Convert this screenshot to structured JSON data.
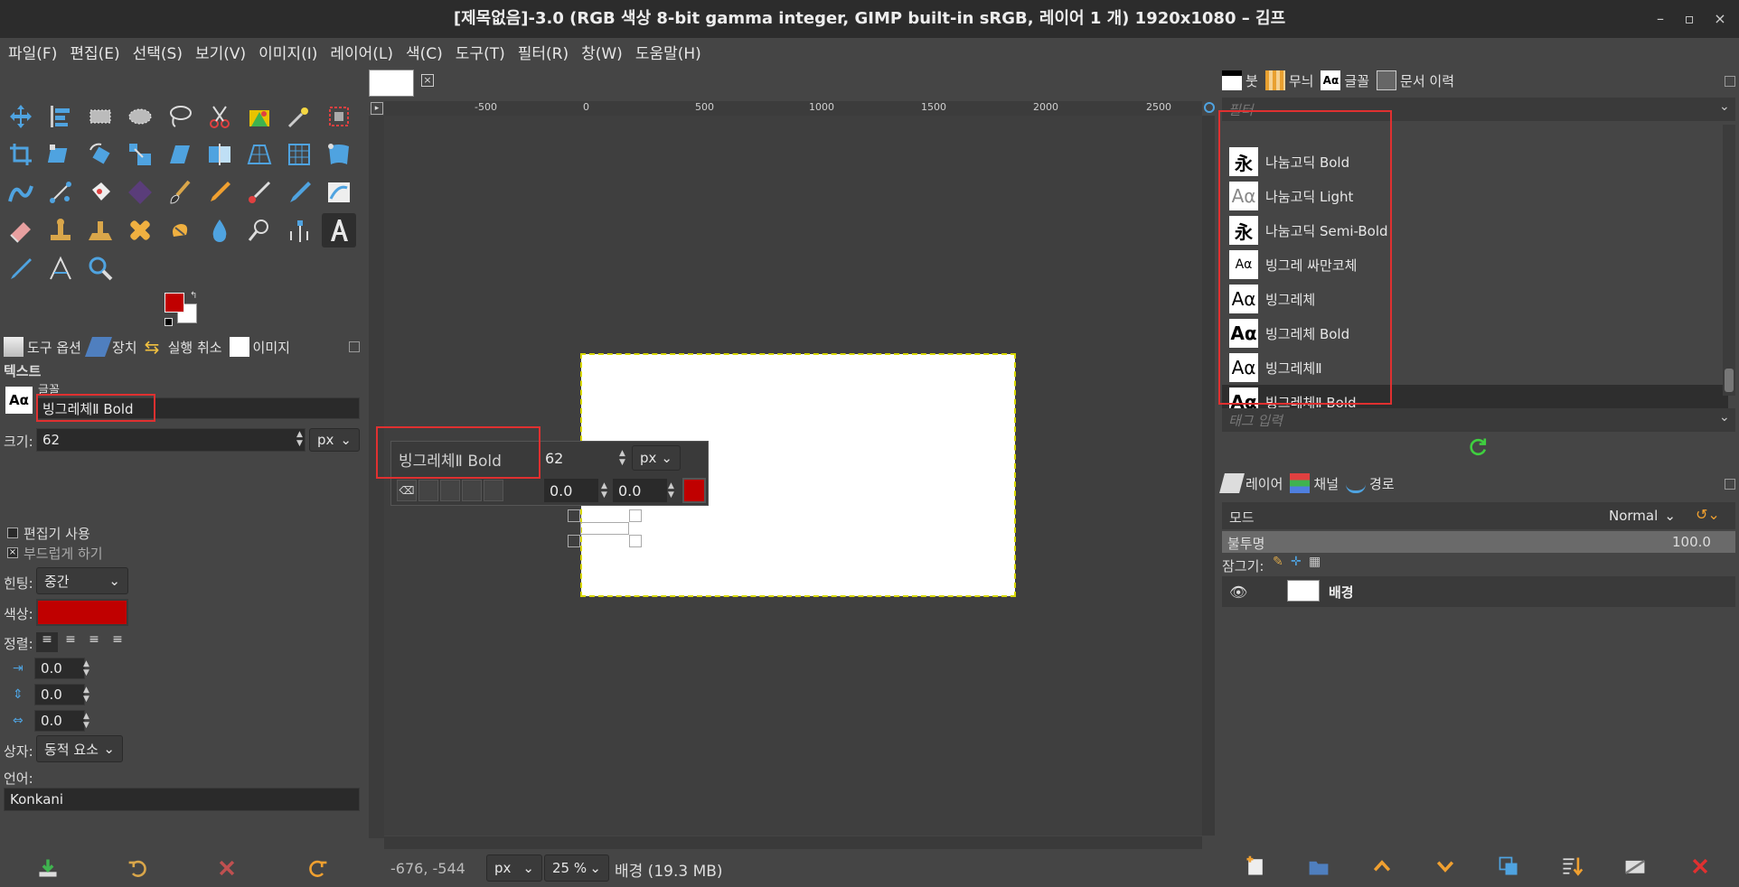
{
  "window": {
    "title": "[제목없음]-3.0 (RGB 색상 8-bit gamma integer, GIMP built-in sRGB, 레이어 1 개) 1920x1080 – 김프",
    "minimize": "–",
    "maximize": "▫",
    "close": "×"
  },
  "menubar": [
    "파일(F)",
    "편집(E)",
    "선택(S)",
    "보기(V)",
    "이미지(I)",
    "레이어(L)",
    "색(C)",
    "도구(T)",
    "필터(R)",
    "창(W)",
    "도움말(H)"
  ],
  "colors": {
    "foreground": "#c00000",
    "background": "#ffffff",
    "highlight": "#e03030",
    "selection_border": "#d8d800"
  },
  "tool_options": {
    "tabs": [
      "도구 옵션",
      "장치",
      "실행 취소",
      "이미지"
    ],
    "section": "텍스트",
    "font_label": "글꼴",
    "font_value": "빙그레체Ⅱ Bold",
    "size_label": "크기:",
    "size_value": "62",
    "size_unit": "px",
    "use_editor": "편집기 사용",
    "antialias": "부드럽게 하기",
    "hinting_label": "힌팅:",
    "hinting_value": "중간",
    "color_label": "색상:",
    "justify_label": "정렬:",
    "indent_value": "0.0",
    "line_spacing_value": "0.0",
    "letter_spacing_value": "0.0",
    "box_label": "상자:",
    "box_value": "동적 요소",
    "language_label": "언어:",
    "language_value": "Konkani"
  },
  "canvas": {
    "ruler_ticks": [
      "-500",
      "0",
      "500",
      "1000",
      "1500",
      "2000",
      "2500"
    ],
    "text_toolbar": {
      "font": "빙그레체Ⅱ Bold",
      "size": "62",
      "unit": "px",
      "baseline": "0.0",
      "kerning": "0.0"
    }
  },
  "status": {
    "coords": "-676, -544",
    "unit": "px",
    "zoom": "25 %",
    "info": "배경 (19.3 MB)"
  },
  "fonts_panel": {
    "tabs": [
      "붓",
      "무늬",
      "글꼴",
      "문서 이력"
    ],
    "filter_placeholder": "필터",
    "fonts": [
      {
        "glyph": "永",
        "name": "나눔고딕 Bold"
      },
      {
        "glyph": "Aα",
        "name": "나눔고딕 Light"
      },
      {
        "glyph": "永",
        "name": "나눔고딕 Semi-Bold"
      },
      {
        "glyph": "Aα",
        "name": "빙그레 싸만코체"
      },
      {
        "glyph": "Aα",
        "name": "빙그레체"
      },
      {
        "glyph": "Aα",
        "name": "빙그레체 Bold"
      },
      {
        "glyph": "Aα",
        "name": "빙그레체Ⅱ"
      },
      {
        "glyph": "Aα",
        "name": "빙그레체Ⅱ Bold"
      }
    ],
    "tag_placeholder": "태그 입력"
  },
  "layers_panel": {
    "tabs": [
      "레이어",
      "채널",
      "경로"
    ],
    "mode_label": "모드",
    "mode_value": "Normal",
    "opacity_label": "불투명",
    "opacity_value": "100.0",
    "lock_label": "잠그기:",
    "layers": [
      {
        "name": "배경"
      }
    ]
  }
}
